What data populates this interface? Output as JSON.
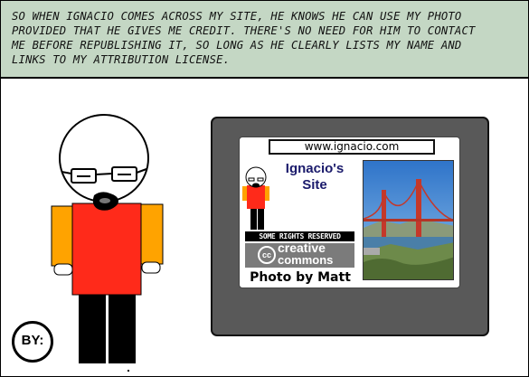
{
  "caption": {
    "lines": [
      "So when Ignacio comes across my site, he knows he can use my photo",
      "provided that he gives me credit.  There's no need for him to contact",
      "me before republishing it, so long as he clearly lists my name and",
      "links to my attribution license."
    ]
  },
  "website": {
    "url": "www.ignacio.com",
    "title_line1": "Ignacio's",
    "title_line2": "Site",
    "rights_text": "SOME RIGHTS RESERVED",
    "cc_symbol": "cc",
    "cc_word1": "creative",
    "cc_word2": "commons",
    "photo_credit": "Photo by Matt"
  },
  "badge": {
    "text": "BY:"
  },
  "colors": {
    "caption_bg": "#c4d7c4",
    "shirt": "#ff2a1a",
    "sleeve": "#ffa300",
    "monitor": "#595959",
    "site_title": "#1a1a6b"
  }
}
